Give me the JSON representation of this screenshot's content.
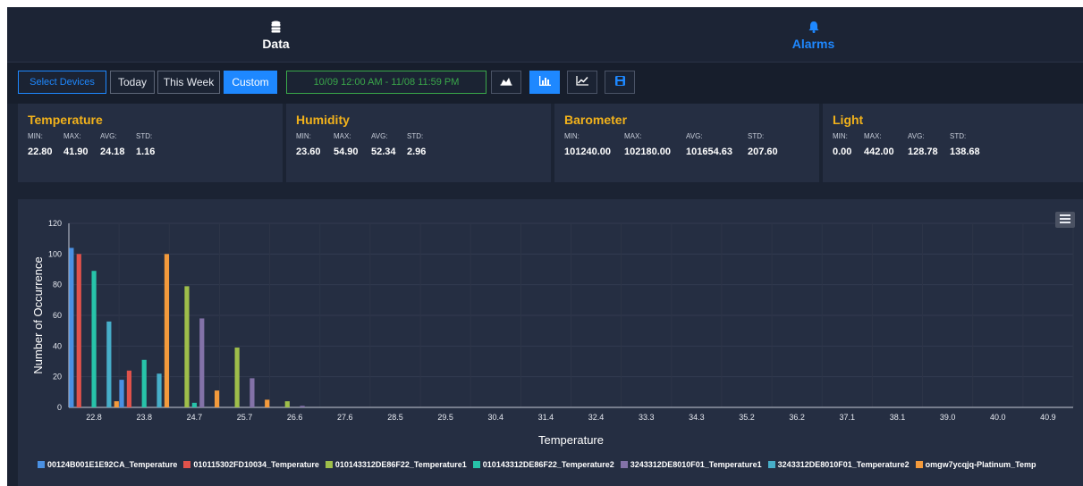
{
  "nav": {
    "data_label": "Data",
    "alarms_label": "Alarms"
  },
  "toolbar": {
    "select_devices": "Select Devices",
    "today": "Today",
    "this_week": "This Week",
    "custom": "Custom",
    "date_range": "10/09 12:00 AM - 11/08 11:59 PM",
    "view_buttons": [
      "area-chart-icon",
      "bar-chart-icon",
      "line-chart-icon",
      "save-icon"
    ],
    "active_view": "bar-chart-icon"
  },
  "cards": [
    {
      "title": "Temperature",
      "labels": [
        "MIN:",
        "MAX:",
        "AVG:",
        "STD:"
      ],
      "values": [
        "22.80",
        "41.90",
        "24.18",
        "1.16"
      ]
    },
    {
      "title": "Humidity",
      "labels": [
        "MIN:",
        "MAX:",
        "AVG:",
        "STD:"
      ],
      "values": [
        "23.60",
        "54.90",
        "52.34",
        "2.96"
      ]
    },
    {
      "title": "Barometer",
      "labels": [
        "MIN:",
        "MAX:",
        "AVG:",
        "STD:"
      ],
      "values": [
        "101240.00",
        "102180.00",
        "101654.63",
        "207.60"
      ]
    },
    {
      "title": "Light",
      "labels": [
        "MIN:",
        "MAX:",
        "AVG:",
        "STD:"
      ],
      "values": [
        "0.00",
        "442.00",
        "128.78",
        "138.68"
      ]
    }
  ],
  "colors": {
    "accent": "#1e88ff",
    "card_title": "#f2b21b",
    "range_text": "#3aa84a",
    "background": "#1b2333",
    "card_bg": "#252e42"
  },
  "chart_data": {
    "type": "bar",
    "xlabel": "Temperature",
    "ylabel": "Number of Occurrence",
    "ylim": [
      0,
      120
    ],
    "yticks": [
      0,
      20,
      40,
      60,
      80,
      100,
      120
    ],
    "grid": true,
    "legend": "bottom",
    "categories": [
      "22.8",
      "23.8",
      "24.7",
      "25.7",
      "26.6",
      "27.6",
      "28.5",
      "29.5",
      "30.4",
      "31.4",
      "32.4",
      "33.3",
      "34.3",
      "35.2",
      "36.2",
      "37.1",
      "38.1",
      "39.0",
      "40.0",
      "40.9"
    ],
    "series": [
      {
        "name": "00124B001E1E92CA_Temperature",
        "color": "#4a90e2",
        "values": [
          104,
          18,
          0,
          0,
          0,
          0,
          0,
          0,
          0,
          0,
          0,
          0,
          0,
          0,
          0,
          0,
          0,
          0,
          0,
          0
        ]
      },
      {
        "name": "010115302FD10034_Temperature",
        "color": "#e0524b",
        "values": [
          100,
          24,
          0,
          0,
          0,
          0,
          0,
          0,
          0,
          0,
          0,
          0,
          0,
          0,
          0,
          0,
          0,
          0,
          0,
          0
        ]
      },
      {
        "name": "010143312DE86F22_Temperature1",
        "color": "#9ebe4a",
        "values": [
          0,
          0,
          79,
          39,
          4,
          0,
          0,
          0,
          0,
          0,
          0,
          0,
          0,
          0,
          0,
          0,
          0,
          0,
          0,
          0
        ]
      },
      {
        "name": "010143312DE86F22_Temperature2",
        "color": "#27c3a9",
        "values": [
          89,
          31,
          3,
          0,
          0,
          0,
          0,
          0,
          0,
          0,
          0,
          0,
          0,
          0,
          0,
          0,
          0,
          0,
          0,
          0
        ]
      },
      {
        "name": "3243312DE8010F01_Temperature1",
        "color": "#8372a8",
        "values": [
          0,
          0,
          58,
          19,
          1,
          0,
          0,
          0,
          0,
          0,
          0,
          0,
          0,
          0,
          0,
          0,
          0,
          0,
          0,
          0
        ]
      },
      {
        "name": "3243312DE8010F01_Temperature2",
        "color": "#47aec9",
        "values": [
          56,
          22,
          0,
          0,
          0,
          0,
          0,
          0,
          0,
          0,
          0,
          0,
          0,
          0,
          0,
          0,
          0,
          0,
          0,
          0
        ]
      },
      {
        "name": "omgw7ycqjq-Platinum_Temp",
        "color": "#f39a3c",
        "values": [
          4,
          100,
          11,
          5,
          0,
          0,
          0,
          0,
          0,
          0,
          0,
          0,
          0,
          0,
          0,
          0,
          0,
          0,
          0,
          0
        ]
      }
    ]
  }
}
